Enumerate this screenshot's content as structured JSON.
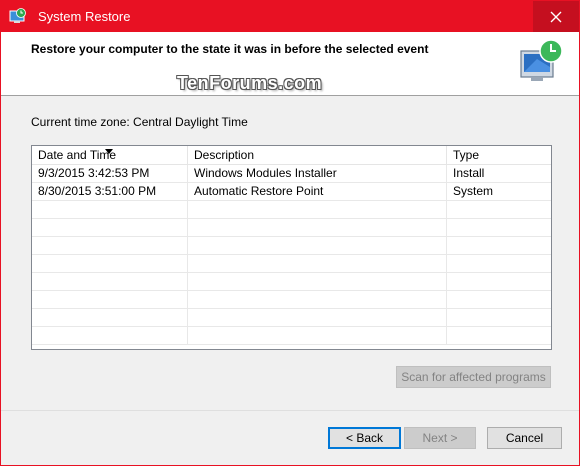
{
  "window": {
    "title": "System Restore"
  },
  "header": {
    "heading": "Restore your computer to the state it was in before the selected event",
    "watermark": "TenForums.com"
  },
  "timezone_label": "Current time zone: Central Daylight Time",
  "table": {
    "columns": [
      "Date and Time",
      "Description",
      "Type"
    ],
    "sorted_column": "Date and Time",
    "rows": [
      {
        "date": "9/3/2015 3:42:53 PM",
        "description": "Windows Modules Installer",
        "type": "Install"
      },
      {
        "date": "8/30/2015 3:51:00 PM",
        "description": "Automatic Restore Point",
        "type": "System"
      }
    ]
  },
  "buttons": {
    "scan": "Scan for affected programs",
    "back": "< Back",
    "next": "Next >",
    "cancel": "Cancel"
  },
  "colors": {
    "titlebar": "#e81123",
    "accent": "#0078d7"
  }
}
